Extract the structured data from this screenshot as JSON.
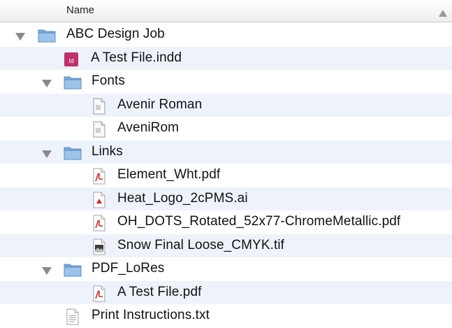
{
  "header": {
    "column_name": "Name",
    "sort": "ascending"
  },
  "rows": [
    {
      "name": "ABC Design Job",
      "kind": "folder",
      "expanded": true
    },
    {
      "name": "A Test File.indd",
      "kind": "indd",
      "badge": "ID"
    },
    {
      "name": "Fonts",
      "kind": "folder",
      "expanded": true
    },
    {
      "name": "Avenir Roman",
      "kind": "font"
    },
    {
      "name": "AveniRom",
      "kind": "font"
    },
    {
      "name": "Links",
      "kind": "folder",
      "expanded": true
    },
    {
      "name": "Element_Wht.pdf",
      "kind": "pdf"
    },
    {
      "name": "Heat_Logo_2cPMS.ai",
      "kind": "ai"
    },
    {
      "name": "OH_DOTS_Rotated_52x77-ChromeMetallic.pdf",
      "kind": "pdf"
    },
    {
      "name": "Snow Final Loose_CMYK.tif",
      "kind": "tif"
    },
    {
      "name": "PDF_LoRes",
      "kind": "folder",
      "expanded": true
    },
    {
      "name": "A Test File.pdf",
      "kind": "pdf"
    },
    {
      "name": "Print Instructions.txt",
      "kind": "txt"
    }
  ],
  "colors": {
    "stripe": "#eef3fb",
    "folder": "#8fb8e3",
    "indd_badge": "#c0306a",
    "pdf_red": "#d4262b",
    "disclosure": "#8a8a8a"
  }
}
